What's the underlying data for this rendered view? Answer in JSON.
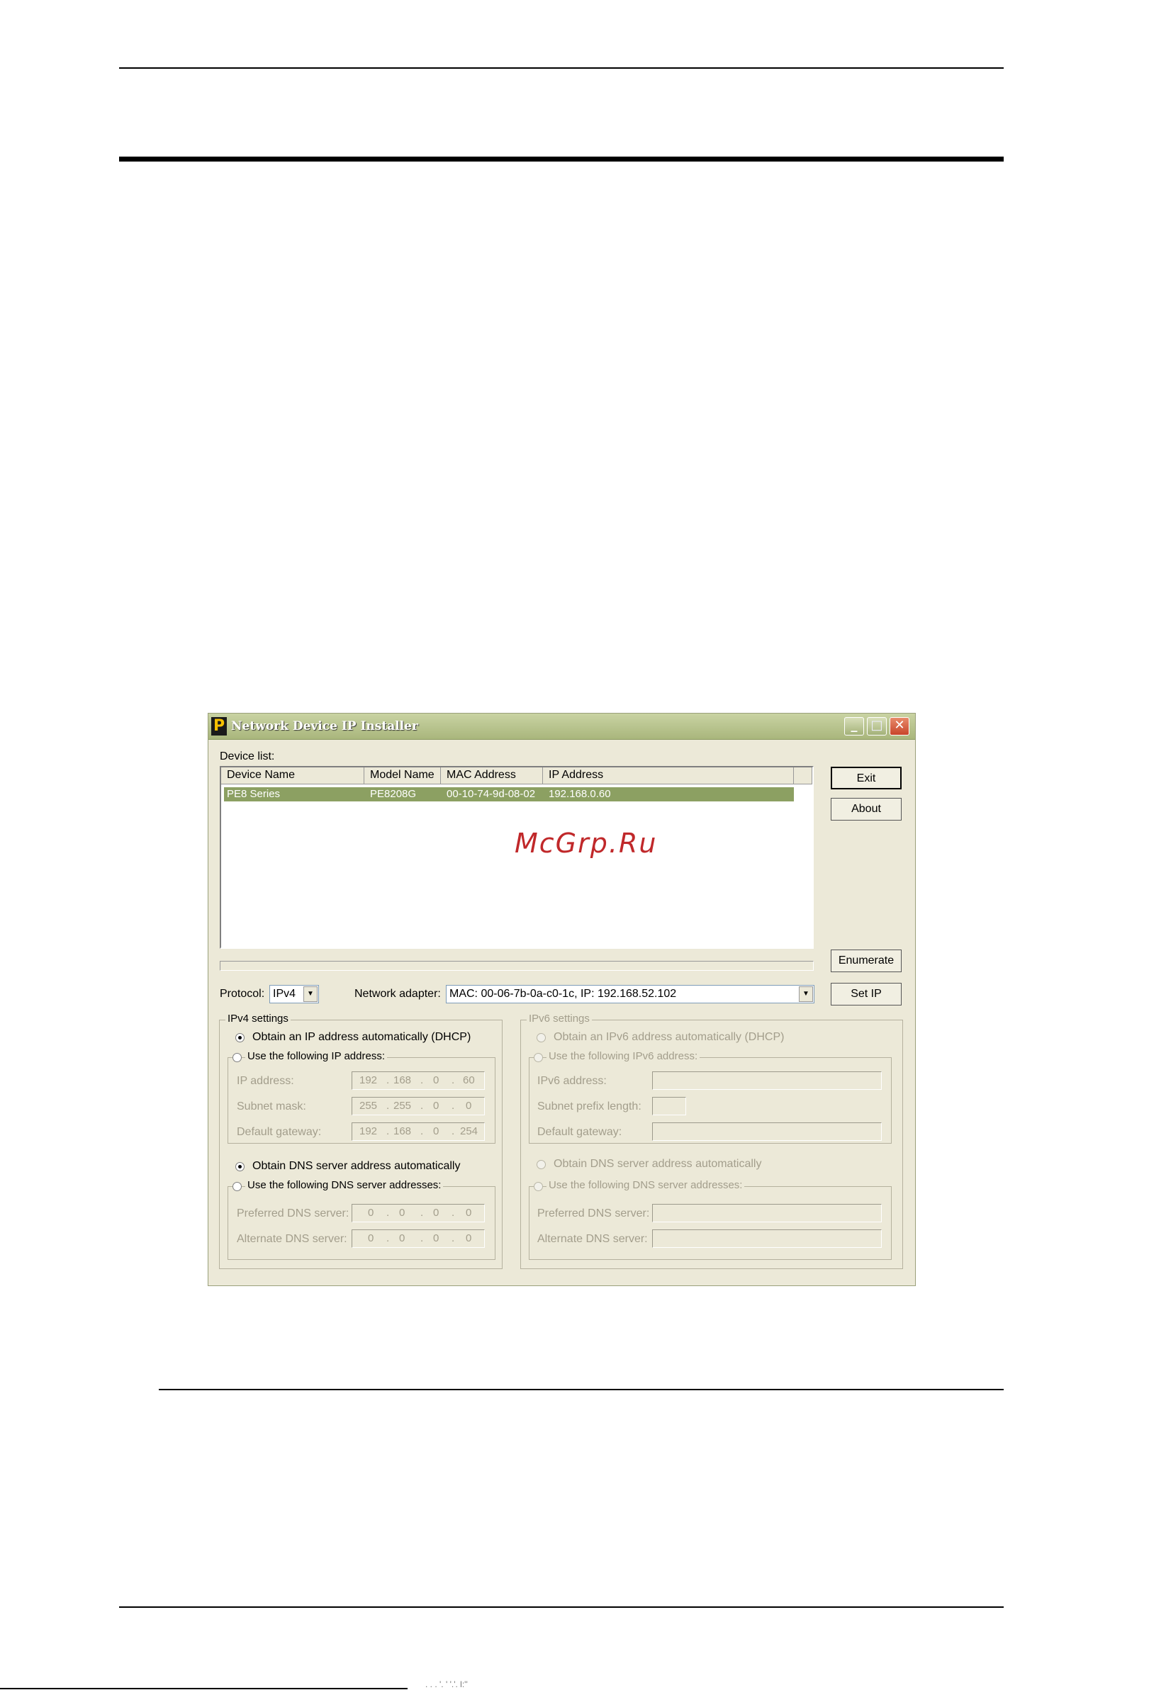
{
  "watermark": "McGrp.Ru",
  "footer_text": ". . . '. ' '.'. l:''",
  "window": {
    "title": "Network Device IP Installer",
    "minimize": "_",
    "maximize": "□",
    "close": "✕",
    "icon": "P"
  },
  "device_list": {
    "label": "Device list:",
    "columns": [
      "Device Name",
      "Model Name",
      "MAC Address",
      "IP Address"
    ],
    "rows": [
      {
        "device_name": "PE8 Series",
        "model_name": "PE8208G",
        "mac": "00-10-74-9d-08-02",
        "ip": "192.168.0.60",
        "selected": true
      }
    ]
  },
  "buttons": {
    "exit": "Exit",
    "about": "About",
    "enumerate": "Enumerate",
    "set_ip": "Set IP"
  },
  "protocol": {
    "label": "Protocol:",
    "value": "IPv4"
  },
  "adapter": {
    "label": "Network adapter:",
    "value": "MAC: 00-06-7b-0a-c0-1c,   IP: 192.168.52.102"
  },
  "ipv4": {
    "title": "IPv4 settings",
    "obtain_auto": "Obtain an IP address automatically (DHCP)",
    "use_following": "Use the following IP address:",
    "ip_label": "IP address:",
    "ip": [
      "192",
      "168",
      "0",
      "60"
    ],
    "mask_label": "Subnet mask:",
    "mask": [
      "255",
      "255",
      "0",
      "0"
    ],
    "gw_label": "Default gateway:",
    "gw": [
      "192",
      "168",
      "0",
      "254"
    ],
    "dns_auto": "Obtain DNS server address automatically",
    "dns_use": "Use the following DNS server addresses:",
    "pref_dns_label": "Preferred DNS server:",
    "pref_dns": [
      "0",
      "0",
      "0",
      "0"
    ],
    "alt_dns_label": "Alternate DNS server:",
    "alt_dns": [
      "0",
      "0",
      "0",
      "0"
    ]
  },
  "ipv6": {
    "title": "IPv6 settings",
    "obtain_auto": "Obtain an IPv6 address automatically (DHCP)",
    "use_following": "Use the following IPv6 address:",
    "ip_label": "IPv6 address:",
    "prefix_label": "Subnet prefix length:",
    "gw_label": "Default gateway:",
    "dns_auto": "Obtain DNS server address automatically",
    "dns_use": "Use the following DNS server addresses:",
    "pref_dns_label": "Preferred DNS server:",
    "alt_dns_label": "Alternate DNS server:"
  }
}
